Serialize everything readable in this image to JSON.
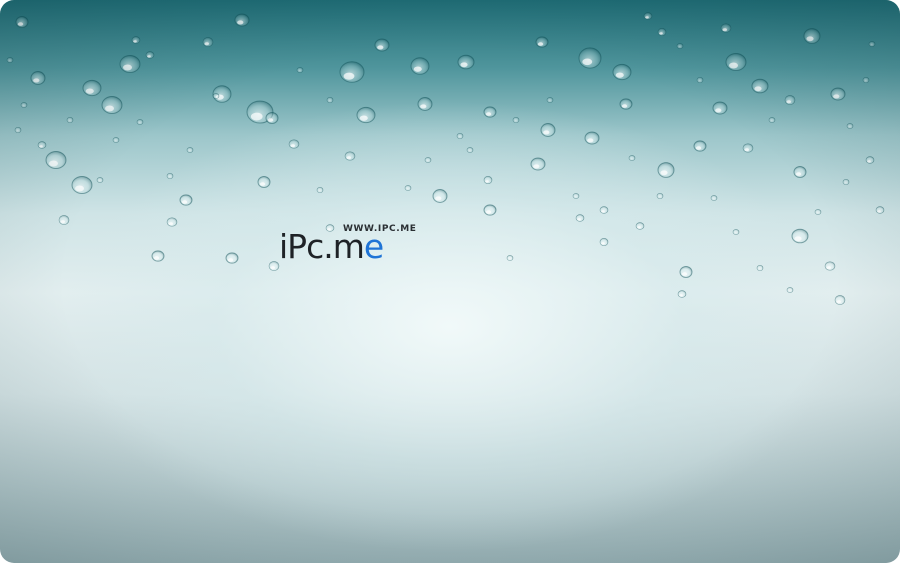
{
  "wallpaper": {
    "colors": {
      "top": "#1f6d76",
      "center": "#e2eeef",
      "bottom": "#96afb3",
      "drop_highlight": "#ffffff",
      "drop_rim": "#0f4f57"
    }
  },
  "logo": {
    "url_text": "WWW.IPC.ME",
    "brand_main": "iPc.m",
    "brand_accent": "e",
    "accent_color": "#1f74d6"
  }
}
